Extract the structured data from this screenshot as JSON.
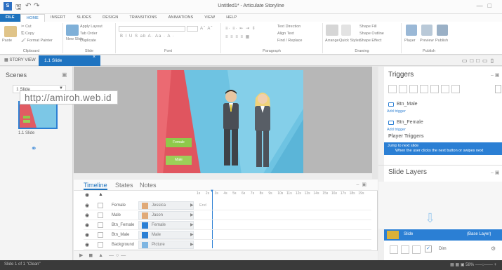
{
  "title_bar": {
    "document_title": "Untitled1* - Articulate Storyline",
    "app_icon_text": "S"
  },
  "tabs": [
    "FILE",
    "HOME",
    "INSERT",
    "SLIDES",
    "DESIGN",
    "TRANSITIONS",
    "ANIMATIONS",
    "VIEW",
    "HELP"
  ],
  "ribbon": {
    "clipboard": {
      "label": "Clipboard",
      "paste": "Paste",
      "cut": "Cut",
      "copy": "Copy",
      "format_painter": "Format Painter"
    },
    "slide": {
      "label": "Slide",
      "new_slide": "New Slide",
      "apply_layout": "Apply Layout",
      "tab_order": "Tab Order",
      "duplicate": "Duplicate"
    },
    "font": {
      "label": "Font"
    },
    "paragraph": {
      "label": "Paragraph",
      "text_direction": "Text Direction",
      "align_text": "Align Text",
      "find_replace": "Find / Replace"
    },
    "drawing": {
      "label": "Drawing",
      "arrange": "Arrange",
      "quick_styles": "Quick Styles",
      "shape_fill": "Shape Fill",
      "shape_outline": "Shape Outline",
      "shape_effect": "Shape Effect"
    },
    "publish": {
      "label": "Publish",
      "player": "Player",
      "preview": "Preview",
      "publish": "Publish"
    }
  },
  "view_bar": {
    "story_view": "STORY VIEW",
    "slide_tab": "1.1 Slide"
  },
  "scenes": {
    "title": "Scenes",
    "selected": "1 Slide",
    "thumb_label": "1.1 Slide"
  },
  "watermark": "http://amiroh.web.id",
  "slide": {
    "buttons": [
      {
        "label": "Female",
        "color": "#8fc94a"
      },
      {
        "label": "Male",
        "color": "#9ccf58"
      }
    ]
  },
  "timeline": {
    "tabs": [
      "Timeline",
      "States",
      "Notes"
    ],
    "ruler": [
      "1s",
      "2s",
      "3s",
      "4s",
      "5s",
      "6s",
      "7s",
      "8s",
      "9s",
      "10s",
      "11s",
      "12s",
      "13s",
      "14s",
      "15s",
      "16s",
      "17s",
      "18s",
      "19s"
    ],
    "end_label": "End",
    "rows": [
      {
        "name": "Female",
        "object": "Jessica",
        "icon": "character-icon"
      },
      {
        "name": "Male",
        "object": "Jason",
        "icon": "character-icon"
      },
      {
        "name": "Btn_Female",
        "object": "Female",
        "icon": "button-icon"
      },
      {
        "name": "Btn_Male",
        "object": "Male",
        "icon": "button-icon"
      },
      {
        "name": "Background",
        "object": "Picture",
        "icon": "picture-icon"
      }
    ]
  },
  "triggers": {
    "title": "Triggers",
    "items": [
      {
        "name": "Btn_Male",
        "add": "Add trigger"
      },
      {
        "name": "Btn_Female",
        "add": "Add trigger"
      }
    ],
    "player_triggers": "Player Triggers",
    "jump_line1": "Jump to next slide",
    "jump_line2": "When the user clicks the next button or swipes next"
  },
  "slide_layers": {
    "title": "Slide Layers",
    "base_layer_name": "Slide",
    "base_layer_tag": "(Base Layer)",
    "dim_label": "Dim"
  },
  "status_bar": {
    "left": "Slide 1 of 1   \"Clean\"",
    "zoom": "58%"
  },
  "colors": {
    "accent": "#2b7fd4",
    "file_tab": "#1e73be",
    "slide_bg": "#6ec3e2",
    "status_bg": "#3a3a3a"
  }
}
